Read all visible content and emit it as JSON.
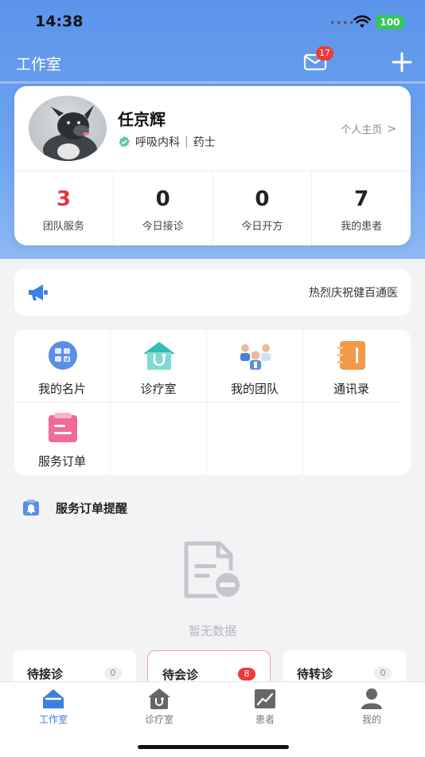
{
  "status_bar": {
    "time": "14:38",
    "battery": "100"
  },
  "nav": {
    "title": "工作室",
    "mail_badge": "17"
  },
  "profile": {
    "name": "任京辉",
    "department": "呼吸内科",
    "title": "药士",
    "homepage_link": "个人主页",
    "stats": [
      {
        "value": "3",
        "label": "团队服务"
      },
      {
        "value": "0",
        "label": "今日接诊"
      },
      {
        "value": "0",
        "label": "今日开方"
      },
      {
        "value": "7",
        "label": "我的患者"
      }
    ]
  },
  "notice": {
    "text": "热烈庆祝健百通医"
  },
  "functions": [
    {
      "label": "我的名片",
      "icon": "business-card-icon"
    },
    {
      "label": "诊疗室",
      "icon": "clinic-icon"
    },
    {
      "label": "我的团队",
      "icon": "team-icon"
    },
    {
      "label": "通讯录",
      "icon": "contacts-icon"
    },
    {
      "label": "服务订单",
      "icon": "service-order-icon"
    }
  ],
  "reminder": {
    "title": "服务订单提醒",
    "empty_text": "暂无数据"
  },
  "status_tabs": [
    {
      "label": "待接诊",
      "count": "0"
    },
    {
      "label": "待会诊",
      "count": "8"
    },
    {
      "label": "待转诊",
      "count": "0"
    }
  ],
  "tabbar": [
    {
      "label": "工作室",
      "icon": "studio-icon",
      "active": true
    },
    {
      "label": "诊疗室",
      "icon": "clinic-icon",
      "active": false
    },
    {
      "label": "患者",
      "icon": "patient-icon",
      "active": false
    },
    {
      "label": "我的",
      "icon": "profile-icon",
      "active": false
    }
  ],
  "colors": {
    "primary": "#5b94ea",
    "accent_red": "#e8353a",
    "tab_active": "#3b7fe0"
  }
}
